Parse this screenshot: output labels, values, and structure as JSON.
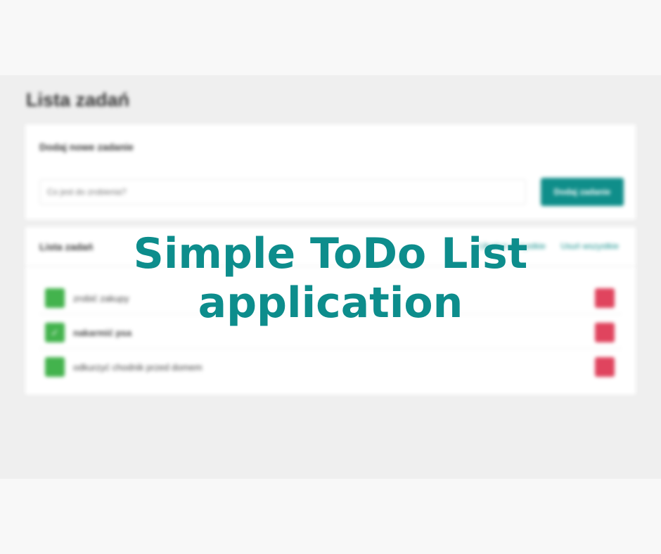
{
  "app": {
    "page_title": "Lista zadań"
  },
  "add_card": {
    "title": "Dodaj nowe zadanie",
    "input_placeholder": "Co jest do zrobienia?",
    "button_label": "Dodaj zadanie"
  },
  "list_card": {
    "title": "Lista zadań",
    "action_1": "Ukończ wszystkie",
    "action_2": "Usuń wszystkie",
    "tasks": [
      {
        "label": "zrobić zakupy",
        "done": false
      },
      {
        "label": "nakarmić psa",
        "done": true
      },
      {
        "label": "odkurzyć chodnik przed domem",
        "done": false
      }
    ]
  },
  "overlay": {
    "line1": "Simple ToDo List",
    "line2": "application"
  },
  "colors": {
    "accent": "#0f8e8a",
    "check_green": "#43b34d",
    "delete_red": "#e0445e",
    "overlay_text": "#0d8d8c"
  },
  "icons": {
    "checkbox": "check-icon",
    "delete": "trash-icon"
  }
}
